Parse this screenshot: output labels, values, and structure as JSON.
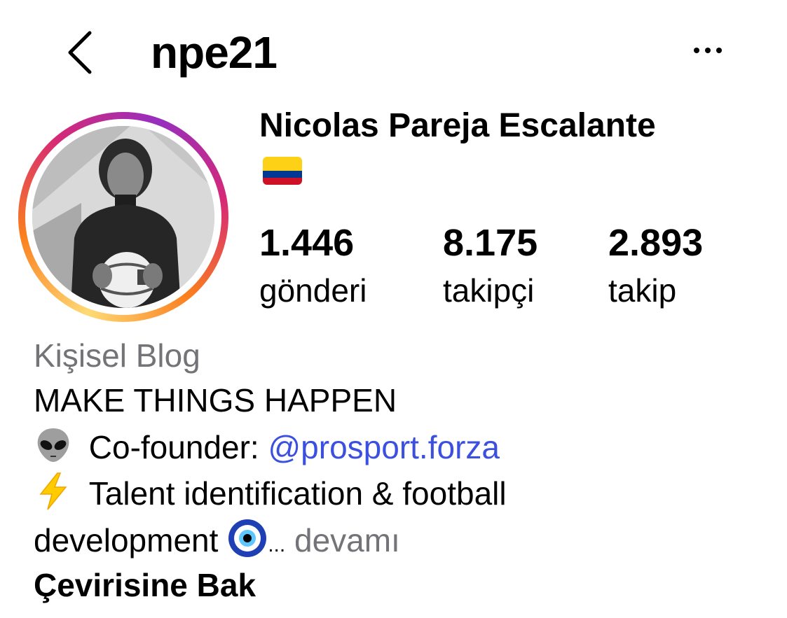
{
  "header": {
    "back_icon": "chevron-left-icon",
    "username": "npe21",
    "more_icon": "ellipsis-icon"
  },
  "profile": {
    "full_name": "Nicolas Pareja Escalante",
    "name_emoji": "colombia-flag-icon",
    "avatar_ring_colors": [
      "#feda75",
      "#fa7e1e",
      "#d62976",
      "#962fbf"
    ]
  },
  "stats": [
    {
      "value": "1.446",
      "label": "gönderi"
    },
    {
      "value": "8.175",
      "label": "takipçi"
    },
    {
      "value": "2.893",
      "label": "takip"
    }
  ],
  "bio": {
    "category": "Kişisel Blog",
    "line1": "MAKE THINGS HAPPEN",
    "line2_prefix": "Co-founder: ",
    "line2_mention": "@prosport.forza",
    "line3": "Talent identification & football",
    "line4": "development",
    "ellipsis": "...",
    "more_label": "devamı",
    "translate_label": "Çevirisine Bak",
    "icons": [
      "alien-icon",
      "lightning-icon",
      "evil-eye-icon"
    ]
  },
  "colors": {
    "mention": "#3b50df",
    "secondary_text": "#737378",
    "text": "#000000"
  }
}
